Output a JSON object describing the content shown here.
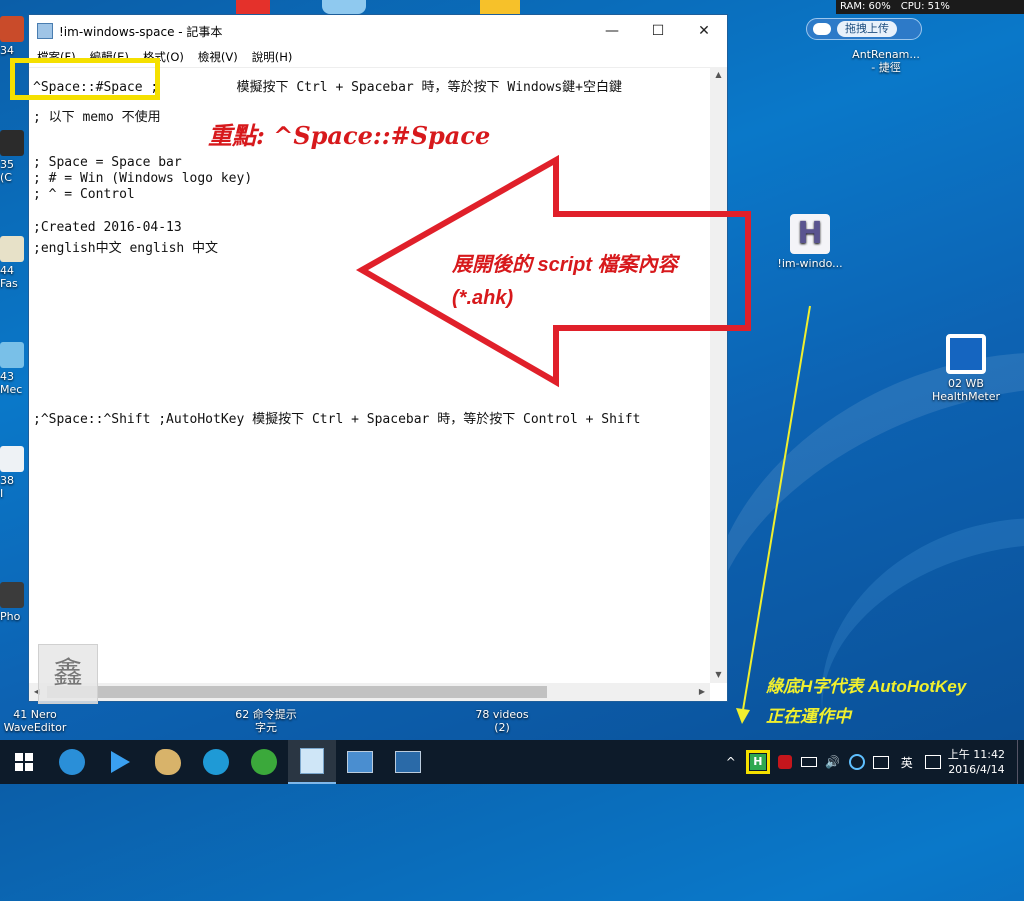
{
  "system_monitor": {
    "ram": "RAM: 60%",
    "cpu": "CPU: 51%"
  },
  "upload_button": {
    "label": "拖拽上传"
  },
  "desktop_icons": [
    {
      "label": "AntRenam...\n- 捷徑"
    },
    {
      "label": "!im-windo..."
    },
    {
      "label": "02 WB\nHealthMeter"
    },
    {
      "label": "62 命令提示\n字元"
    },
    {
      "label": "78 videos\n(2)"
    },
    {
      "label": "41 Nero\nWaveEditor"
    }
  ],
  "left_edge_labels": [
    "34",
    "35\n(C",
    "44\nFas",
    "43\nMec",
    "38\nI",
    "Pho"
  ],
  "notepad": {
    "title": "!im-windows-space - 記事本",
    "menu": [
      "檔案(F)",
      "編輯(E)",
      "格式(O)",
      "檢視(V)",
      "說明(H)"
    ],
    "lines": [
      "^Space::#Space ;          模擬按下 Ctrl + Spacebar 時，等於按下 Windows鍵+空白鍵",
      "; 以下 memo 不使用",
      "; Space = Space bar",
      "; # = Win (Windows logo key)",
      "; ^ = Control",
      ";Created 2016-04-13",
      ";english中文 english 中文",
      ";^Space::^Shift ;AutoHotKey 模擬按下 Ctrl + Spacebar 時，等於按下 Control + Shift"
    ],
    "stamp_text": "鑫"
  },
  "annotations": {
    "key_point": "重點: ^Space::#Space",
    "arrow_text_1": "展開後的 script 檔案內容",
    "arrow_text_2": "(*.ahk)",
    "green_h_1": "綠底H字代表 AutoHotKey",
    "green_h_2": "正在運作中"
  },
  "tray": {
    "caret": "^",
    "ime": "英",
    "time": "上午 11:42",
    "date": "2016/4/14",
    "ahk_letter": "H"
  },
  "colors": {
    "desktop_bg": "#0a78c9",
    "annotation_red": "#d7191c",
    "annotation_yellow": "#f0ef2e",
    "highlight_yellow": "#f5e000",
    "ahk_green": "#2fa84f"
  }
}
